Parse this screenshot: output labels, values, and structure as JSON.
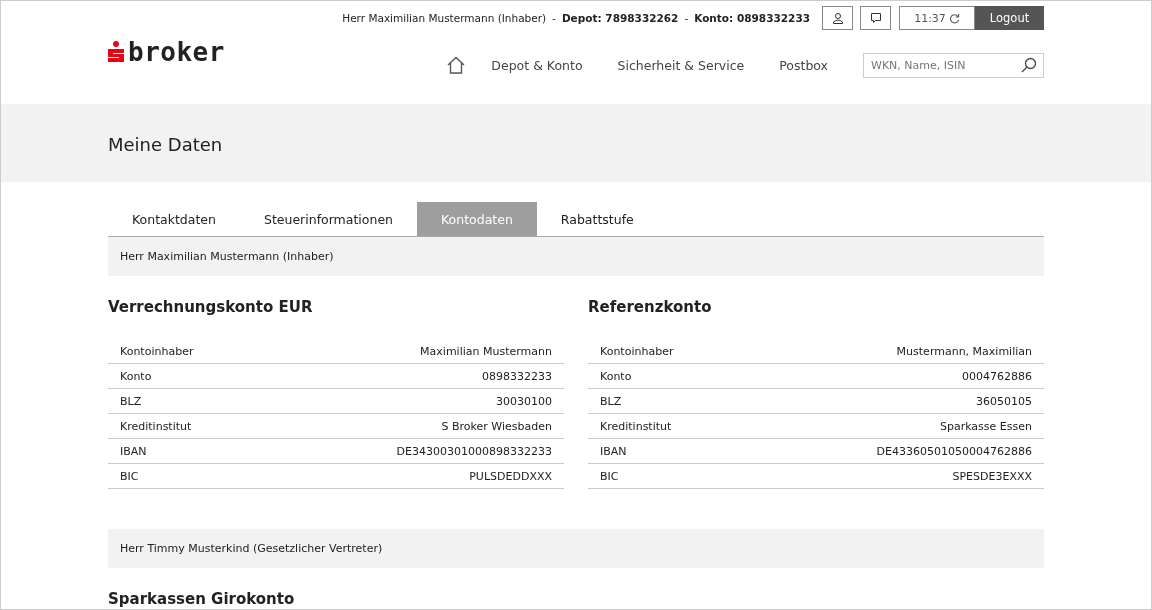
{
  "header": {
    "logo_text": "broker",
    "user": "Herr Maximilian Mustermann (Inhaber)",
    "separator_1": "-",
    "depot_label": "Depot: 7898332262",
    "separator_2": "-",
    "konto_label": "Konto: 0898332233",
    "time": "11:37",
    "logout": "Logout"
  },
  "nav": {
    "items": [
      "Depot & Konto",
      "Sicherheit & Service",
      "Postbox"
    ],
    "search": {
      "placeholder": "WKN, Name, ISIN"
    }
  },
  "page_title": "Meine Daten",
  "tabs": [
    {
      "label": "Kontaktdaten",
      "selected": false
    },
    {
      "label": "Steuerinformationen",
      "selected": false
    },
    {
      "label": "Kontodaten",
      "selected": true
    },
    {
      "label": "Rabattstufe",
      "selected": false
    }
  ],
  "holders": [
    {
      "name": "Herr Maximilian Mustermann (Inhaber)",
      "accounts": [
        {
          "title": "Verrechnungskonto EUR",
          "rows": [
            [
              "Kontoinhaber",
              "Maximilian Mustermann"
            ],
            [
              "Konto",
              "0898332233"
            ],
            [
              "BLZ",
              "30030100"
            ],
            [
              "Kreditinstitut",
              "S Broker Wiesbaden"
            ],
            [
              "IBAN",
              "DE34300301000898332233"
            ],
            [
              "BIC",
              "PULSDEDDXXX"
            ]
          ]
        },
        {
          "title": "Referenzkonto",
          "rows": [
            [
              "Kontoinhaber",
              "Mustermann, Maximilian"
            ],
            [
              "Konto",
              "0004762886"
            ],
            [
              "BLZ",
              "36050105"
            ],
            [
              "Kreditinstitut",
              "Sparkasse Essen"
            ],
            [
              "IBAN",
              "DE43360501050004762886"
            ],
            [
              "BIC",
              "SPESDE3EXXX"
            ]
          ]
        }
      ]
    },
    {
      "name": "Herr Timmy Musterkind (Gesetzlicher Vertreter)",
      "accounts": [
        {
          "title": "Sparkassen Girokonto"
        }
      ]
    }
  ]
}
